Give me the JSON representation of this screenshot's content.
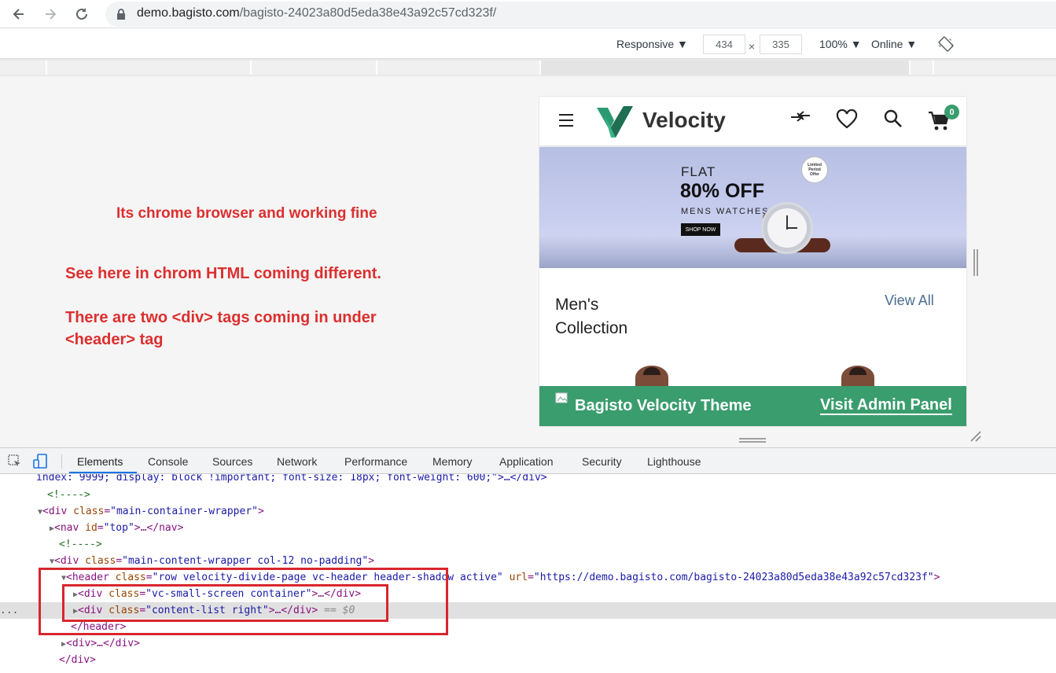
{
  "browser": {
    "url_host": "demo.bagisto.com",
    "url_path": "/bagisto-24023a80d5eda38e43a92c57cd323f/"
  },
  "device_toolbar": {
    "device": "Responsive ▼",
    "width": "434",
    "times": "×",
    "height": "335",
    "zoom": "100% ▼",
    "network": "Online ▼"
  },
  "notes": {
    "line1": "Its chrome browser and working fine",
    "line2": "See here in chrom HTML coming different.",
    "line3": "There are two <div> tags coming in under",
    "line4": "<header> tag"
  },
  "site": {
    "brand": "Velocity",
    "cart_count": "0",
    "banner": {
      "flat": "FLAT",
      "offer": "80% OFF",
      "product": "MENS WATCHES",
      "cta": "SHOP NOW",
      "badge": "Limited Period Offer"
    },
    "collection_title_1": "Men's",
    "collection_title_2": "Collection",
    "view_all": "View All",
    "footer_title": "Bagisto Velocity Theme",
    "footer_link": "Visit Admin Panel"
  },
  "devtools": {
    "tabs": [
      "Elements",
      "Console",
      "Sources",
      "Network",
      "Performance",
      "Memory",
      "Application",
      "Security",
      "Lighthouse"
    ],
    "lines": {
      "l0": "index: 9999; display: block !important; font-size: 18px; font-weight: 600;\">…</div>",
      "l1": "<!---->",
      "l2_tag": "<div ",
      "l2_an": "class",
      "l2_av": "\"main-container-wrapper\"",
      "l2_end": ">",
      "l3_tag": "<nav ",
      "l3_an": "id",
      "l3_av": "\"top\"",
      "l3_end": ">…</nav>",
      "l4": "<!---->",
      "l5_tag": "<div ",
      "l5_an": "class",
      "l5_av": "\"main-content-wrapper col-12 no-padding\"",
      "l5_end": ">",
      "l6_tag": "<header ",
      "l6_an": "class",
      "l6_av": "\"row velocity-divide-page vc-header header-shadow active\"",
      "l6_an2": " url",
      "l6_av2": "\"https://demo.bagisto.com/bagisto-24023a80d5eda38e43a92c57cd323f\"",
      "l6_end": ">",
      "l7_tag": "<div ",
      "l7_an": "class",
      "l7_av": "\"vc-small-screen container\"",
      "l7_end": ">…</div>",
      "l8_tag": "<div ",
      "l8_an": "class",
      "l8_av": "\"content-list right\"",
      "l8_end": ">…</div>",
      "l8_hint": " == $0",
      "l9": "</header>",
      "l10": "<div>…</div>",
      "l11": "</div>",
      "ellipsis": "..."
    }
  },
  "colors": {
    "annotation_red": "#dd2f2f",
    "velocity_green": "#3a9d6e",
    "view_all_blue": "#4a6c91"
  }
}
